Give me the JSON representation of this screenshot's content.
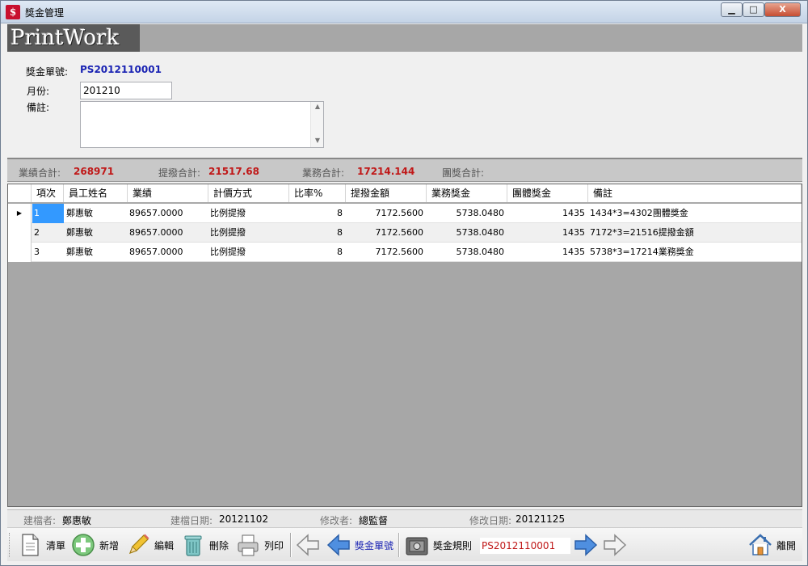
{
  "window": {
    "title": "獎金管理",
    "controls": {
      "minimize": "▁",
      "maximize": "□",
      "close": "X"
    }
  },
  "banner": {
    "logo": "PrintWork"
  },
  "form": {
    "bonus_no_label": "獎金單號:",
    "bonus_no_value": "PS2012110001",
    "month_label": "月份:",
    "month_value": "201210",
    "note_label": "備註:",
    "note_value": ""
  },
  "totals": {
    "performance_label": "業績合計:",
    "performance_value": "268971",
    "commission_label": "提撥合計:",
    "commission_value": "21517.68",
    "business_label": "業務合計:",
    "business_value": "17214.144",
    "team_label": "團獎合計:",
    "team_value": ""
  },
  "grid": {
    "columns": [
      "項次",
      "員工姓名",
      "業績",
      "計價方式",
      "比率%",
      "提撥金額",
      "業務獎金",
      "團體獎金",
      "備註"
    ],
    "rows": [
      {
        "no": "1",
        "name": "鄭惠敏",
        "perf": "89657.0000",
        "method": "比例提撥",
        "rate": "8",
        "commission": "7172.5600",
        "business": "5738.0480",
        "team": "1435",
        "note": "1434*3=4302團體獎金"
      },
      {
        "no": "2",
        "name": "鄭惠敏",
        "perf": "89657.0000",
        "method": "比例提撥",
        "rate": "8",
        "commission": "7172.5600",
        "business": "5738.0480",
        "team": "1435",
        "note": "7172*3=21516提撥金額"
      },
      {
        "no": "3",
        "name": "鄭惠敏",
        "perf": "89657.0000",
        "method": "比例提撥",
        "rate": "8",
        "commission": "7172.5600",
        "business": "5738.0480",
        "team": "1435",
        "note": "5738*3=17214業務獎金"
      }
    ],
    "current_row_marker": "▶"
  },
  "info": {
    "creator_label": "建檔者:",
    "creator_value": "鄭惠敏",
    "created_date_label": "建檔日期:",
    "created_date_value": "20121102",
    "modifier_label": "修改者:",
    "modifier_value": "總監督",
    "modified_date_label": "修改日期:",
    "modified_date_value": "20121125"
  },
  "toolbar": {
    "list_label": "清單",
    "add_label": "新增",
    "edit_label": "編輯",
    "delete_label": "刪除",
    "print_label": "列印",
    "bonus_no_label": "獎金單號",
    "rule_label": "獎金規則",
    "rule_value": "PS2012110001",
    "exit_label": "離開"
  }
}
